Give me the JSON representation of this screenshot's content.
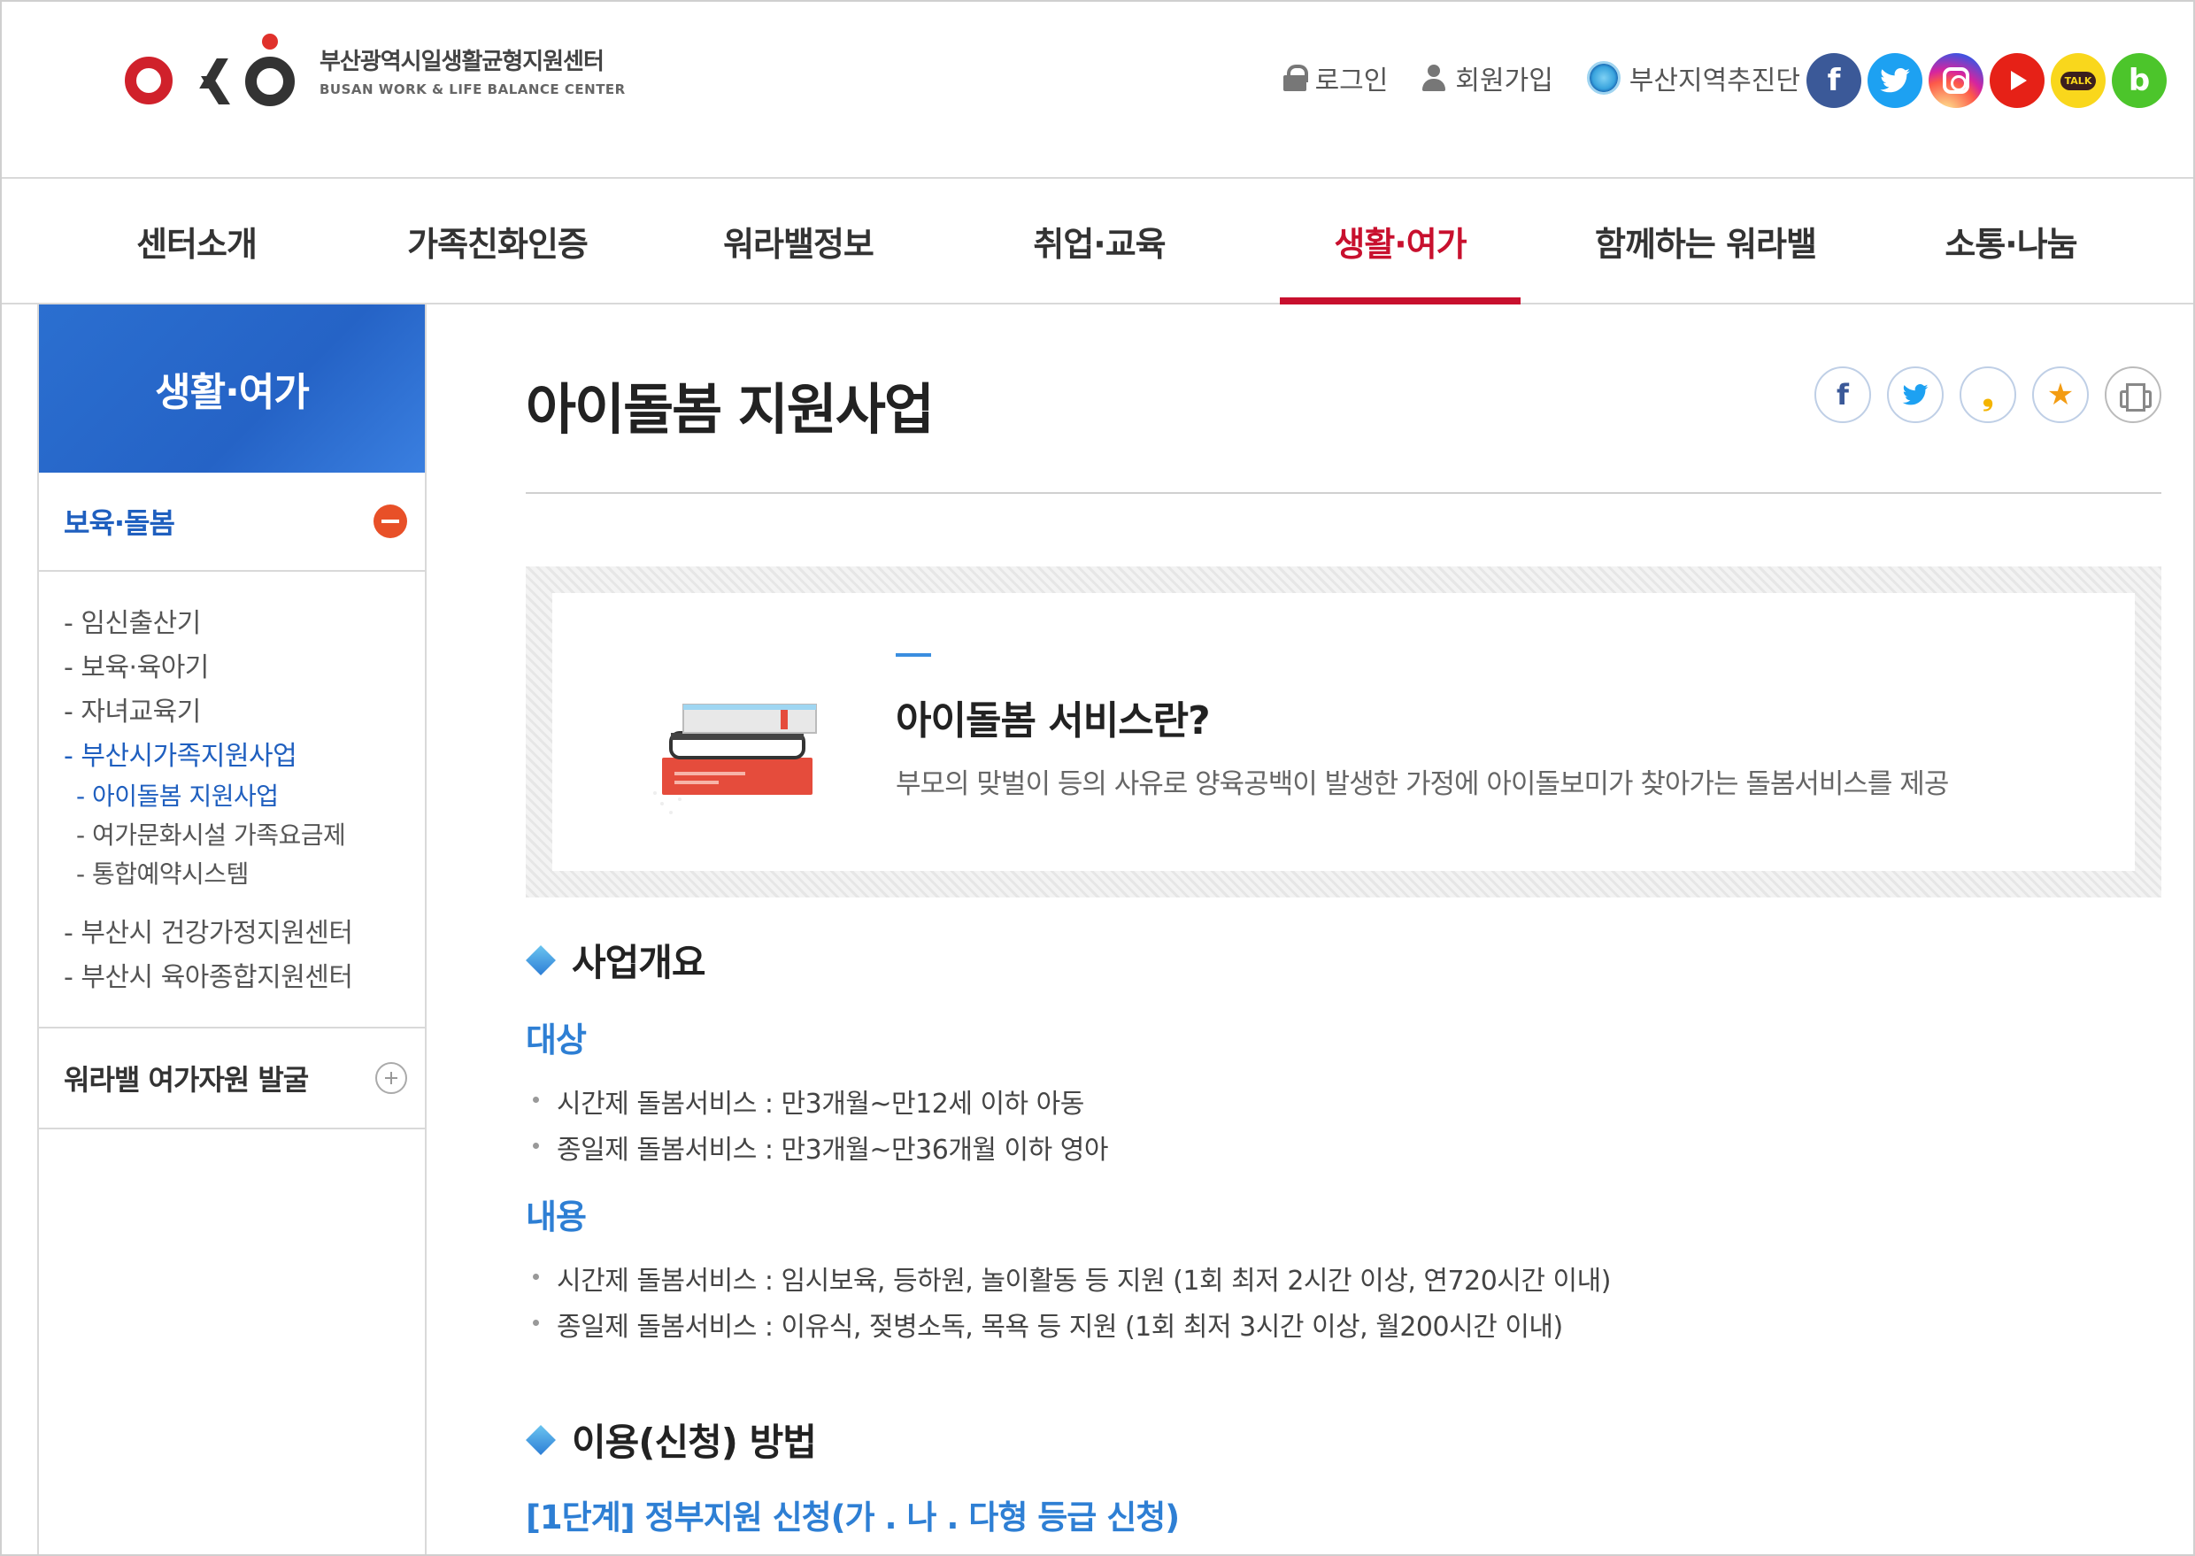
{
  "header": {
    "logo_ko": "부산광역시일생활균형지원센터",
    "logo_en": "BUSAN WORK & LIFE BALANCE CENTER",
    "util": {
      "login": "로그인",
      "join": "회원가입",
      "promo": "부산지역추진단"
    },
    "sns": {
      "facebook": "f",
      "bandlabel": "b",
      "talk": "TALK"
    }
  },
  "gnb": [
    "센터소개",
    "가족친화인증",
    "워라밸정보",
    "취업·교육",
    "생활·여가",
    "함께하는 워라밸",
    "소통·나눔"
  ],
  "lnb": {
    "title": "생활·여가",
    "group1": "보육·돌봄",
    "items": [
      "- 임신출산기",
      "- 보육·육아기",
      "- 자녀교육기",
      "- 부산시가족지원사업"
    ],
    "sub_items": [
      "- 아이돌봄 지원사업",
      "- 여가문화시설 가족요금제",
      "- 통합예약시스템"
    ],
    "items2": [
      "- 부산시 건강가정지원센터",
      "- 부산시 육아종합지원센터"
    ],
    "group2": "워라밸 여가자원 발굴"
  },
  "content": {
    "title": "아이돌봄 지원사업",
    "share": {
      "facebook": "f",
      "kakao": "❟",
      "bookmark": "★"
    },
    "intro_heading": "아이돌봄 서비스란?",
    "intro_text": "부모의 맞벌이 등의 사유로 양육공백이 발생한 가정에 아이돌보미가 찾아가는 돌봄서비스를 제공",
    "section1": "사업개요",
    "target_label": "대상",
    "target_items": [
      "시간제 돌봄서비스 : 만3개월~만12세 이하 아동",
      "종일제 돌봄서비스 : 만3개월~만36개월 이하 영아"
    ],
    "content_label": "내용",
    "content_items": [
      "시간제 돌봄서비스 : 임시보육, 등하원, 놀이활동 등 지원 (1회 최저 2시간 이상, 연720시간 이내)",
      "종일제 돌봄서비스 : 이유식, 젖병소독, 목욕 등 지원 (1회 최저 3시간 이상, 월200시간 이내)"
    ],
    "section2": "이용(신청) 방법",
    "step1": "[1단계] 정부지원 신청(가 . 나 . 다형 등급 신청)"
  },
  "colors": {
    "accent_red": "#c8102e",
    "accent_blue": "#2e7fd4",
    "lnb_blue": "#2563c6"
  }
}
